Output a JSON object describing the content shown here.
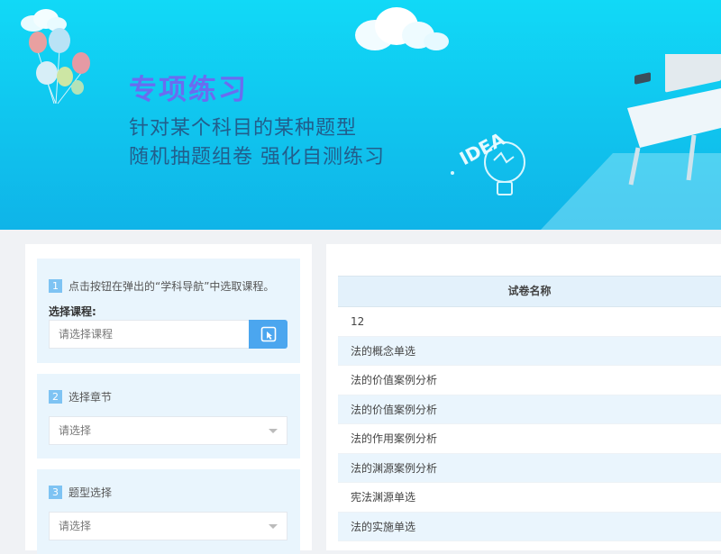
{
  "banner": {
    "title": "专项练习",
    "subtitle_line1": "针对某个科目的某种题型",
    "subtitle_line2": "随机抽题组卷  强化自测练习",
    "illustration_text": "IDEA"
  },
  "steps": {
    "step1": {
      "number": "1",
      "text": "点击按钮在弹出的“学科导航”中选取课程。",
      "course_label": "选择课程:",
      "course_placeholder": "请选择课程",
      "button_icon": "cursor-select-icon"
    },
    "step2": {
      "number": "2",
      "text": "选择章节",
      "select_value": "请选择"
    },
    "step3": {
      "number": "3",
      "text": "题型选择",
      "select_value": "请选择"
    }
  },
  "table": {
    "header": "试卷名称",
    "rows": [
      "12",
      "法的概念单选",
      "法的价值案例分析",
      "法的价值案例分析",
      "法的作用案例分析",
      "法的渊源案例分析",
      "宪法渊源单选",
      "法的实施单选"
    ]
  },
  "colors": {
    "banner_top": "#11d9f7",
    "title": "#6a6cf0",
    "subtitle": "#225e8c",
    "accent_button": "#4ba6ef",
    "step_badge": "#7ec3f3",
    "step_bg": "#e9f5fd"
  }
}
